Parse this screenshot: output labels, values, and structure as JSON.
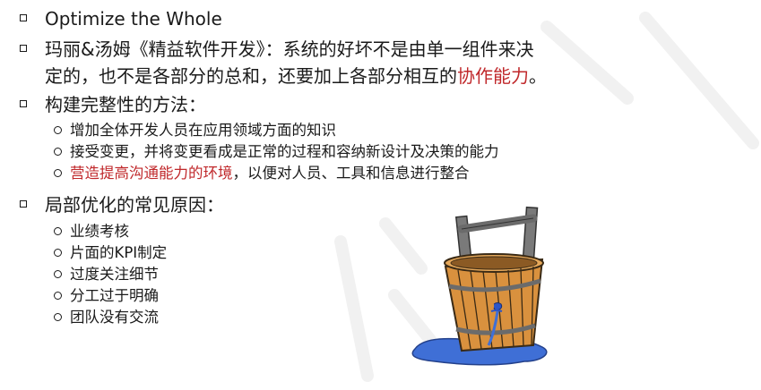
{
  "bullets": {
    "b1": {
      "text": "Optimize the Whole"
    },
    "b2": {
      "line1": "玛丽&汤姆《精益软件开发》：系统的好坏不是由单一组件来决",
      "line2_plain": "定的，也不是各部分的总和，还要加上各部分相互的",
      "line2_highlight": "协作能力",
      "line2_end": "。"
    },
    "b3": {
      "heading": "构建完整性的方法：",
      "items": [
        "增加全体开发人员在应用领域方面的知识",
        "接受变更，并将变更看成是正常的过程和容纳新设计及决策的能力"
      ],
      "item3_highlight": "营造提高沟通能力的环境",
      "item3_rest": "，以便对人员、工具和信息进行整合"
    },
    "b4": {
      "heading": "局部优化的常见原因：",
      "items": [
        "业绩考核",
        "片面的KPI制定",
        "过度关注细节",
        "分工过于明确",
        "团队没有交流"
      ]
    }
  },
  "colors": {
    "text": "#1a1a1a",
    "highlight": "#c0282b",
    "bucket_wood": "#d9913e",
    "bucket_band": "#6b6b6b",
    "water": "#3f6fd6"
  },
  "illustration": "leaking-wooden-bucket-icon"
}
